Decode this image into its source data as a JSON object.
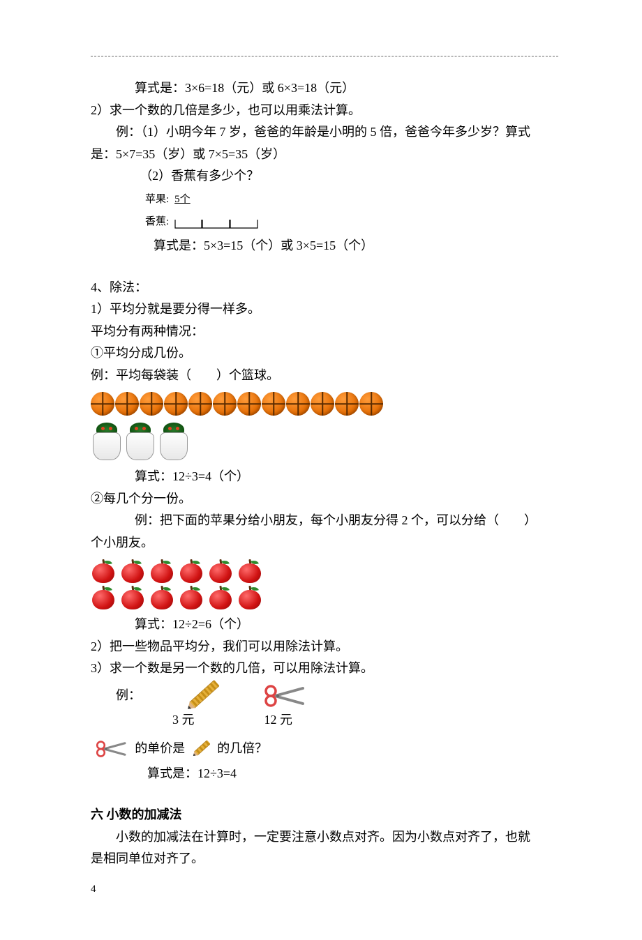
{
  "top": {
    "eq1": "算式是：3×6=18（元）或 6×3=18（元）"
  },
  "s2": {
    "t": "2）求一个数的几倍是多少，也可以用乘法计算。",
    "ex1": "例：（1）小明今年 7 岁，爸爸的年龄是小明的 5 倍，爸爸今年多少岁？算式",
    "ex1b": "是：5×7=35（岁）或 7×5=35（岁）",
    "ex2": "（2）香蕉有多少个？",
    "apple_label": "苹果:",
    "apple_count": "5个",
    "banana_label": "香蕉:",
    "eq": "算式是：5×3=15（个）或 3×5=15（个）"
  },
  "s4": {
    "t": "4、除法：",
    "l1": "1）平均分就是要分得一样多。",
    "l2": "平均分有两种情况：",
    "l3": "①平均分成几份。",
    "l4": "例：平均每袋装（  ）个篮球。",
    "eq1": "算式：12÷3=4（个）",
    "l5": "②每几个分一份。",
    "l6": "例：把下面的苹果分给小朋友，每个小朋友分得 2 个，可以分给（  ）",
    "l6b": "个小朋友。",
    "eq2": "算式：12÷2=6（个）",
    "l7": "2）把一些物品平均分，我们可以用除法计算。",
    "l8": "3）求一个数是另一个数的几倍，可以用除法计算。",
    "ex_label": "例：",
    "price1": "3 元",
    "price2": "12 元",
    "q_mid": "的单价是",
    "q_end": "的几倍？",
    "eq3": "算式是：12÷3=4"
  },
  "s6": {
    "t": "六 小数的加减法",
    "p1": "小数的加减法在计算时，一定要注意小数点对齐。因为小数点对齐了，也就",
    "p2": "是相同单位对齐了。"
  },
  "page": "4"
}
